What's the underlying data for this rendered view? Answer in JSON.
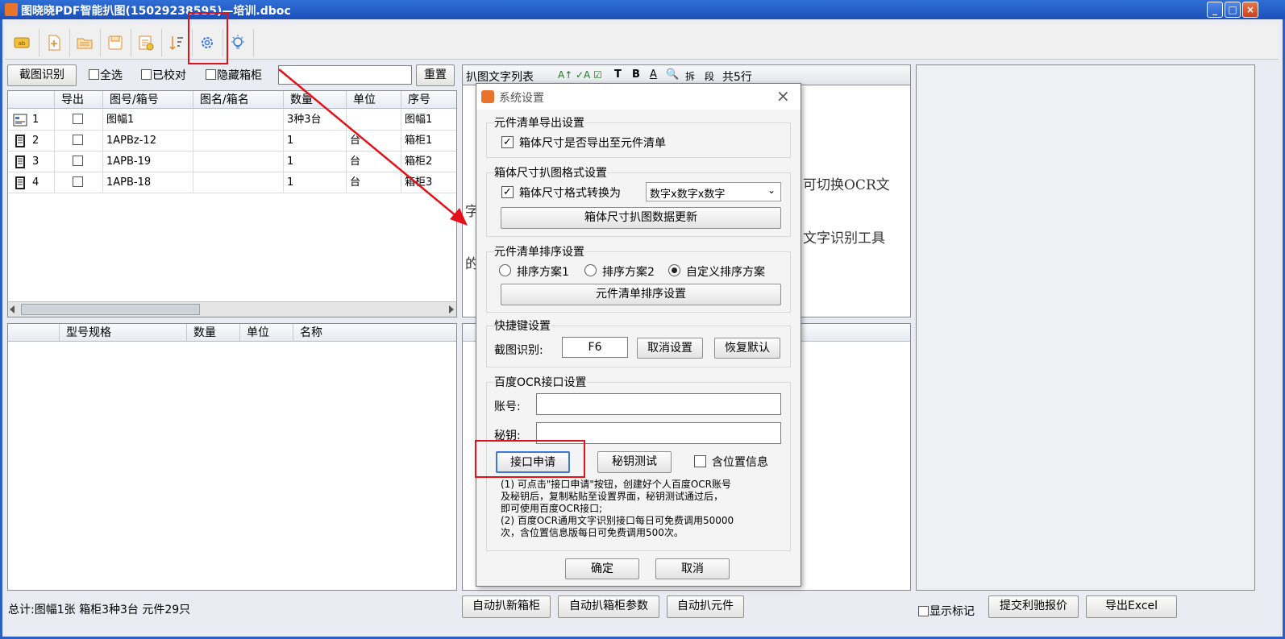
{
  "window": {
    "title": "图晓晓PDF智能扒图(15029238595)—培训.dboc",
    "btn_min": "_",
    "btn_max": "□",
    "btn_close": "×"
  },
  "left_controls": {
    "capture_button": "截图识别",
    "select_all": "全选",
    "verified": "已校对",
    "hide_cabinet": "隐藏箱柜",
    "search_value": "",
    "reset_button": "重置"
  },
  "top_grid": {
    "columns": [
      "导出",
      "图号/箱号",
      "图名/箱名",
      "数量",
      "单位",
      "序号"
    ],
    "rows": [
      {
        "n": "1",
        "code": "图幅1",
        "name": "",
        "qty": "3种3台",
        "unit": "",
        "seq": "图幅1"
      },
      {
        "n": "2",
        "code": "1APBz-12",
        "name": "",
        "qty": "1",
        "unit": "台",
        "seq": "箱柜1"
      },
      {
        "n": "3",
        "code": "1APB-19",
        "name": "",
        "qty": "1",
        "unit": "台",
        "seq": "箱柜2"
      },
      {
        "n": "4",
        "code": "1APB-18",
        "name": "",
        "qty": "1",
        "unit": "台",
        "seq": "箱柜3"
      }
    ]
  },
  "bottom_grid": {
    "columns": [
      "型号规格",
      "数量",
      "单位",
      "名称"
    ]
  },
  "text_panel": {
    "title": "扒图文字列表",
    "tool_t": "T",
    "tool_b": "B",
    "tool_a": "A",
    "tool_split": "拆",
    "tool_para": "段",
    "line_count": "共5行",
    "body_1": "可切换OCR文",
    "body_2": "字",
    "body_3": "文字识别工具",
    "body_4": "的"
  },
  "status": {
    "summary": "总计:图幅1张 箱柜3种3台 元件29只",
    "auto_new_cabinet": "自动扒新箱柜",
    "auto_cabinet_params": "自动扒箱柜参数",
    "auto_components": "自动扒元件",
    "show_marks": "显示标记",
    "submit_quote": "提交利驰报价",
    "export_excel": "导出Excel"
  },
  "dialog": {
    "title": "系统设置",
    "close": "×",
    "g1_title": "元件清单导出设置",
    "g1_check": "箱体尺寸是否导出至元件清单",
    "g1_check_mark": "✓",
    "g2_title": "箱体尺寸扒图格式设置",
    "g2_check": "箱体尺寸格式转换为",
    "g2_check_mark": "✓",
    "g2_select": "数字x数字x数字",
    "g2_button": "箱体尺寸扒图数据更新",
    "g3_title": "元件清单排序设置",
    "g3_opt1": "排序方案1",
    "g3_opt2": "排序方案2",
    "g3_opt3": "自定义排序方案",
    "g3_button": "元件清单排序设置",
    "g4_title": "快捷键设置",
    "g4_label": "截图识别:",
    "g4_value": "F6",
    "g4_cancel": "取消设置",
    "g4_restore": "恢复默认",
    "g5_title": "百度OCR接口设置",
    "g5_account": "账号:",
    "g5_secret": "秘钥:",
    "g5_apply": "接口申请",
    "g5_test": "秘钥测试",
    "g5_location": "含位置信息",
    "note_1": "(1) 可点击\"接口申请\"按钮，创建好个人百度OCR账号",
    "note_2": "及秘钥后，复制粘贴至设置界面，秘钥测试通过后，",
    "note_3": "即可使用百度OCR接口;",
    "note_4": "(2) 百度OCR通用文字识别接口每日可免费调用50000",
    "note_5": "次，含位置信息版每日可免费调用500次。",
    "ok": "确定",
    "cancel": "取消"
  },
  "colors": {
    "titlebar": "#1c4fb8",
    "highlight": "#e3121a"
  }
}
